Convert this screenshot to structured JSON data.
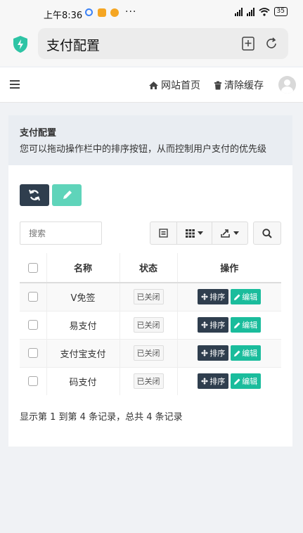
{
  "statusbar": {
    "time": "上午8:36",
    "dots": "···",
    "battery": "35"
  },
  "browser": {
    "page_title": "支付配置"
  },
  "topnav": {
    "home_link": "网站首页",
    "clear_cache_link": "清除缓存"
  },
  "panel": {
    "title": "支付配置",
    "subtitle": "您可以拖动操作栏中的排序按钮，从而控制用户支付的优先级"
  },
  "search": {
    "placeholder": "搜索"
  },
  "table": {
    "columns": [
      "名称",
      "状态",
      "操作"
    ],
    "sort_label": "排序",
    "edit_label": "编辑",
    "rows": [
      {
        "name": "V免签",
        "status": "已关闭"
      },
      {
        "name": "易支付",
        "status": "已关闭"
      },
      {
        "name": "支付宝支付",
        "status": "已关闭"
      },
      {
        "name": "码支付",
        "status": "已关闭"
      }
    ]
  },
  "pagination": {
    "summary": "显示第 1 到第 4 条记录，总共 4 条记录"
  },
  "colors": {
    "dark_button": "#2f3e4e",
    "edit_button": "#1abc9c",
    "shield": "#2ec4a5"
  }
}
